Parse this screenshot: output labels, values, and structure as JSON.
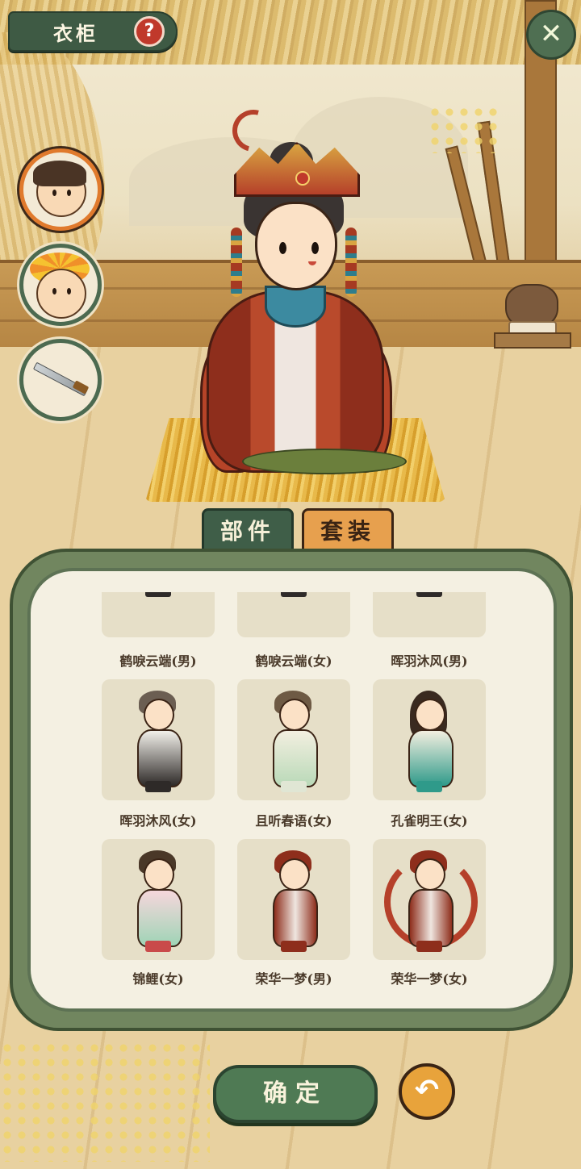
{
  "header": {
    "title": "衣柜",
    "help_glyph": "?",
    "close_glyph": "✕"
  },
  "side_selectors": [
    {
      "icon": "boy-hero-icon",
      "active": true
    },
    {
      "icon": "monkey-king-icon",
      "active": false
    },
    {
      "icon": "sword-icon",
      "active": false
    }
  ],
  "tabs": {
    "parts": "部件",
    "sets": "套装",
    "active": "parts"
  },
  "outfits": [
    {
      "label": "鹤唳云端(男)",
      "partially_visible": true
    },
    {
      "label": "鹤唳云端(女)",
      "partially_visible": true
    },
    {
      "label": "晖羽沐风(男)",
      "partially_visible": true
    },
    {
      "label": "晖羽沐风(女)"
    },
    {
      "label": "且听春语(女)"
    },
    {
      "label": "孔雀明王(女)"
    },
    {
      "label": "锦鲤(女)"
    },
    {
      "label": "荣华一梦(男)"
    },
    {
      "label": "荣华一梦(女)"
    }
  ],
  "footer": {
    "confirm": "确定",
    "undo_glyph": "↶"
  },
  "colors": {
    "accent_green": "#3f5e48",
    "accent_orange": "#e7a04e",
    "panel_bg": "#f4f0e2"
  }
}
